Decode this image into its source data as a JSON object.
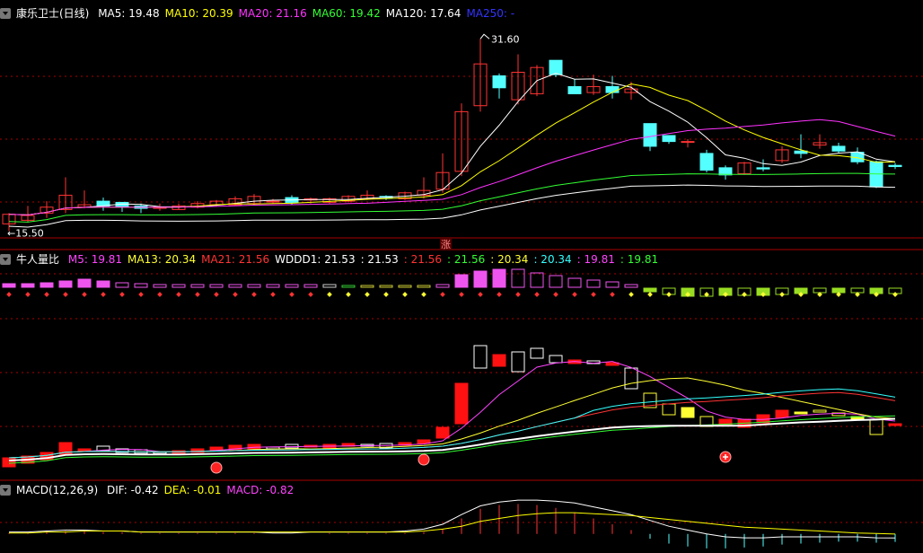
{
  "main_legend": {
    "name": "康乐卫士(日线)",
    "items": [
      {
        "label": "MA5: 19.48",
        "color": "#ffffff"
      },
      {
        "label": "MA10: 20.39",
        "color": "#ffff00"
      },
      {
        "label": "MA20: 21.16",
        "color": "#ff33ff"
      },
      {
        "label": "MA60: 19.42",
        "color": "#33ff33"
      },
      {
        "label": "MA120: 17.64",
        "color": "#ffffff"
      },
      {
        "label": "MA250: -",
        "color": "#3333ff"
      }
    ]
  },
  "vol_legend": {
    "name": "牛人量比",
    "items": [
      {
        "label": "M5: 19.81",
        "color": "#ff44ff"
      },
      {
        "label": "MA13: 20.34",
        "color": "#ffff33"
      },
      {
        "label": "MA21: 21.56",
        "color": "#ff3333"
      },
      {
        "label": "WDDD1: 21.53",
        "color": "#ffffff"
      },
      {
        "label": ": 21.53",
        "color": "#ffffff"
      },
      {
        "label": ": 21.56",
        "color": "#ff3333"
      },
      {
        "label": ": 21.56",
        "color": "#33ff33"
      },
      {
        "label": ": 20.34",
        "color": "#ffff33"
      },
      {
        "label": ": 20.34",
        "color": "#33ffff"
      },
      {
        "label": ": 19.81",
        "color": "#ff44ff"
      },
      {
        "label": ": 19.81",
        "color": "#33ff33"
      }
    ]
  },
  "macd_legend": {
    "name": "MACD(12,26,9)",
    "items": [
      {
        "label": "DIF: -0.42",
        "color": "#ffffff"
      },
      {
        "label": "DEA: -0.01",
        "color": "#ffff00"
      },
      {
        "label": "MACD: -0.82",
        "color": "#ff44ff"
      }
    ]
  },
  "annotations": {
    "high": "31.60",
    "low": "15.50",
    "limit_up": "涨"
  },
  "colors": {
    "up": "#ff3333",
    "down": "#54ffff",
    "grid": "#aa0000",
    "ma120": "#ffffff"
  },
  "chart_data": [
    {
      "type": "candlestick",
      "panel": "price",
      "x_dates": "unlabeled daily bars",
      "open": [
        16.1,
        16.4,
        17.0,
        17.3,
        17.5,
        18.0,
        17.9,
        17.6,
        17.4,
        17.3,
        17.5,
        17.7,
        17.7,
        17.8,
        18.0,
        18.3,
        18.1,
        17.9,
        18.0,
        18.2,
        18.4,
        18.2,
        18.5,
        19.0,
        20.5,
        26.0,
        28.5,
        26.5,
        27.0,
        29.8,
        27.6,
        27.1,
        27.6,
        27.1,
        24.5,
        23.5,
        23.0,
        22.0,
        20.8,
        20.3,
        20.8,
        21.4,
        22.2,
        22.7,
        22.6,
        22.1,
        21.3,
        21.0
      ],
      "close": [
        16.9,
        16.8,
        17.5,
        18.5,
        17.7,
        17.6,
        17.5,
        17.4,
        17.5,
        17.6,
        17.8,
        18.0,
        18.2,
        18.4,
        18.0,
        17.9,
        18.2,
        18.2,
        18.4,
        18.5,
        18.3,
        18.7,
        18.9,
        20.4,
        25.5,
        29.5,
        27.5,
        28.8,
        29.2,
        28.6,
        27.0,
        27.6,
        27.1,
        27.4,
        22.6,
        23.0,
        23.0,
        20.6,
        20.2,
        21.2,
        20.7,
        22.3,
        22.0,
        22.9,
        22.2,
        21.3,
        19.2,
        20.9
      ],
      "high": [
        17.0,
        17.6,
        18.0,
        20.0,
        18.9,
        18.3,
        17.8,
        17.8,
        17.8,
        17.8,
        18.0,
        18.1,
        18.4,
        18.6,
        18.2,
        18.5,
        18.3,
        18.3,
        18.5,
        18.9,
        18.5,
        18.8,
        20.0,
        22.0,
        26.2,
        31.6,
        28.7,
        30.3,
        29.4,
        29.2,
        28.2,
        28.6,
        28.5,
        28.0,
        24.0,
        23.5,
        23.2,
        22.3,
        21.0,
        21.3,
        21.5,
        22.6,
        23.6,
        23.6,
        22.9,
        22.5,
        21.4,
        21.2
      ],
      "low": [
        15.5,
        16.2,
        16.6,
        17.0,
        17.4,
        17.2,
        17.1,
        17.0,
        17.2,
        17.3,
        17.4,
        17.6,
        17.6,
        17.7,
        17.8,
        17.7,
        17.8,
        17.8,
        17.9,
        18.1,
        18.1,
        18.1,
        18.2,
        18.7,
        20.1,
        25.5,
        26.6,
        26.1,
        26.8,
        28.4,
        27.0,
        26.9,
        26.6,
        26.5,
        22.2,
        22.8,
        22.5,
        20.4,
        19.8,
        20.2,
        20.5,
        21.2,
        21.6,
        22.4,
        22.0,
        21.1,
        19.1,
        20.7
      ],
      "ylim": [
        15.3,
        33.5
      ],
      "moving_averages": [
        {
          "name": "MA5",
          "color": "#ffffff"
        },
        {
          "name": "MA10",
          "color": "#ffff00"
        },
        {
          "name": "MA20",
          "color": "#ff33ff"
        },
        {
          "name": "MA60",
          "color": "#33ff33"
        },
        {
          "name": "MA120",
          "color": "#ffffff"
        }
      ]
    },
    {
      "type": "bar",
      "panel": "volume_ratio_strip",
      "values": [
        4,
        4,
        5,
        7,
        9,
        7,
        5,
        4,
        3,
        3,
        3,
        3,
        3,
        3,
        3,
        3,
        3,
        3,
        2,
        2,
        2,
        2,
        2,
        3,
        14,
        18,
        20,
        20,
        16,
        13,
        10,
        8,
        6,
        3,
        -4,
        -7,
        -9,
        -9,
        -8,
        -8,
        -8,
        -7,
        -6,
        -5,
        -5,
        -5,
        -6,
        -6
      ],
      "colors": [
        "#ee55ee",
        "#ee55ee",
        "#ee55ee",
        "#ee55ee",
        "#ee55ee",
        "#ee55ee",
        "#ee55ee",
        "#ee55ee",
        "#ee55ee",
        "#ee55ee",
        "#ee55ee",
        "#ee55ee",
        "#ee55ee",
        "#ee55ee",
        "#ee55ee",
        "#ee55ee",
        "#ee55ee",
        "#cccccc",
        "#33cc33",
        "#cccc33",
        "#cccc33",
        "#cccc33",
        "#cccc33",
        "#ee55ee",
        "#ee55ee",
        "#ee55ee",
        "#ee55ee",
        "#ee55ee",
        "#ee55ee",
        "#ee55ee",
        "#ee55ee",
        "#ee55ee",
        "#ee55ee",
        "#ee55ee",
        "#99dd22",
        "#99dd22",
        "#99dd22",
        "#99dd22",
        "#99dd22",
        "#99dd22",
        "#99dd22",
        "#99dd22",
        "#99dd22",
        "#99dd22",
        "#99dd22",
        "#99dd22",
        "#99dd22",
        "#99dd22"
      ],
      "dot_colors": [
        "#ff3333",
        "#ff3333",
        "#ff3333",
        "#ff3333",
        "#ff3333",
        "#ff3333",
        "#ff3333",
        "#ff3333",
        "#ff3333",
        "#ff3333",
        "#ff3333",
        "#ff3333",
        "#ff3333",
        "#ff3333",
        "#ff3333",
        "#ff3333",
        "#ff3333",
        "#ffff33",
        "#ffff33",
        "#ffff33",
        "#ffff33",
        "#ffff33",
        "#ffff33",
        "#ff3333",
        "#ff3333",
        "#ff3333",
        "#ff3333",
        "#ff3333",
        "#ff3333",
        "#ff3333",
        "#ff3333",
        "#ff3333",
        "#ff3333",
        "#ffff33",
        "#ffff33",
        "#ffff33",
        "#ffff33",
        "#ffff33",
        "#ffff33",
        "#ffff33",
        "#ffff33",
        "#ffff33",
        "#ffff33",
        "#ffff33",
        "#ffff33",
        "#ffff33",
        "#ffff33",
        "#ffff33"
      ]
    },
    {
      "type": "candlestick",
      "panel": "volume_ratio_indicator",
      "open": [
        16.0,
        16.4,
        16.8,
        17.4,
        17.8,
        18.3,
        18.0,
        17.9,
        17.7,
        17.5,
        17.6,
        17.8,
        17.9,
        18.0,
        18.2,
        18.5,
        18.2,
        18.1,
        18.3,
        18.5,
        18.6,
        18.4,
        18.6,
        19.2,
        20.8,
        29.5,
        27.2,
        28.8,
        29.2,
        28.4,
        27.5,
        27.8,
        27.3,
        27.0,
        24.2,
        23.0,
        22.6,
        21.6,
        20.6,
        20.4,
        20.9,
        21.5,
        22.1,
        22.3,
        22.0,
        21.6,
        21.3,
        20.7
      ],
      "close": [
        17.0,
        17.2,
        17.6,
        18.7,
        18.0,
        17.8,
        17.6,
        17.5,
        17.6,
        17.8,
        18.0,
        18.2,
        18.4,
        18.5,
        18.0,
        18.1,
        18.4,
        18.5,
        18.6,
        18.3,
        18.1,
        18.7,
        19.0,
        20.4,
        25.3,
        27.0,
        28.5,
        26.6,
        28.1,
        27.6,
        27.9,
        27.5,
        27.6,
        24.7,
        22.6,
        21.8,
        21.5,
        20.5,
        21.3,
        21.3,
        21.8,
        22.3,
        21.9,
        22.1,
        21.7,
        21.3,
        19.6,
        20.8
      ],
      "ylim": [
        15.5,
        30.0
      ],
      "lines": [
        {
          "name": "M5",
          "color": "#ff44ff"
        },
        {
          "name": "MA13",
          "color": "#ffff33"
        },
        {
          "name": "MA21",
          "color": "#ff3333"
        },
        {
          "name": "WDDD1",
          "color": "#ffffff"
        }
      ],
      "markers": [
        {
          "index": 11,
          "kind": "red-ball"
        },
        {
          "index": 22,
          "kind": "red-ball"
        },
        {
          "index": 38,
          "kind": "red-ball-plus"
        }
      ]
    },
    {
      "type": "bar",
      "panel": "macd",
      "macd": [
        0.1,
        0.1,
        0.2,
        0.3,
        0.3,
        0.2,
        0.2,
        0.1,
        0.1,
        0.1,
        0.1,
        0.1,
        0.1,
        0.1,
        0.0,
        0.0,
        0.0,
        0.1,
        0.1,
        0.1,
        0.1,
        0.1,
        0.2,
        0.5,
        1.6,
        2.6,
        3.0,
        3.1,
        3.0,
        2.7,
        2.2,
        1.6,
        1.0,
        0.4,
        -0.5,
        -1.0,
        -1.3,
        -1.5,
        -1.5,
        -1.4,
        -1.3,
        -1.1,
        -1.0,
        -0.9,
        -0.8,
        -0.8,
        -0.9,
        -0.82
      ],
      "dif": [
        0.2,
        0.2,
        0.3,
        0.4,
        0.4,
        0.3,
        0.3,
        0.2,
        0.2,
        0.2,
        0.2,
        0.2,
        0.2,
        0.2,
        0.1,
        0.1,
        0.2,
        0.2,
        0.2,
        0.2,
        0.2,
        0.3,
        0.5,
        1.0,
        2.0,
        2.9,
        3.3,
        3.5,
        3.5,
        3.4,
        3.2,
        2.8,
        2.4,
        2.0,
        1.4,
        0.8,
        0.4,
        0.0,
        -0.3,
        -0.4,
        -0.4,
        -0.3,
        -0.3,
        -0.3,
        -0.3,
        -0.3,
        -0.4,
        -0.42
      ],
      "dea": [
        0.1,
        0.1,
        0.2,
        0.2,
        0.3,
        0.3,
        0.3,
        0.2,
        0.2,
        0.2,
        0.2,
        0.2,
        0.2,
        0.2,
        0.2,
        0.2,
        0.2,
        0.2,
        0.2,
        0.2,
        0.2,
        0.2,
        0.3,
        0.5,
        0.8,
        1.3,
        1.6,
        1.9,
        2.1,
        2.2,
        2.2,
        2.1,
        2.0,
        1.9,
        1.7,
        1.5,
        1.3,
        1.1,
        0.9,
        0.7,
        0.6,
        0.5,
        0.4,
        0.3,
        0.2,
        0.1,
        0.05,
        -0.01
      ],
      "ylim": [
        -1.6,
        3.6
      ]
    }
  ]
}
